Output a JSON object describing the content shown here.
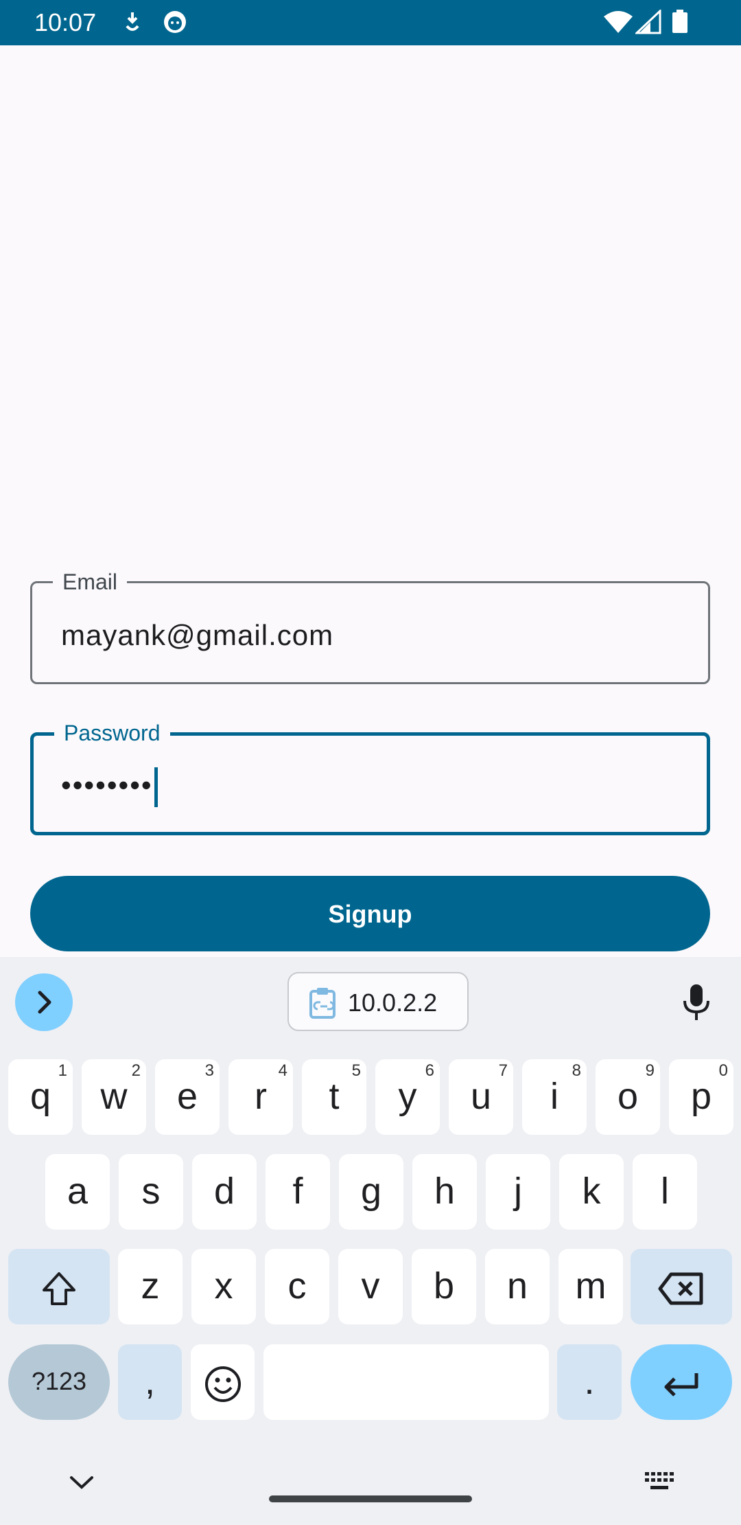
{
  "status_bar": {
    "time": "10:07"
  },
  "form": {
    "email": {
      "label": "Email",
      "value": "mayank@gmail.com"
    },
    "password": {
      "label": "Password",
      "value": "••••••••"
    },
    "signup_label": "Signup"
  },
  "keyboard": {
    "clipboard_suggestion": "10.0.2.2",
    "row1": [
      {
        "k": "q",
        "h": "1"
      },
      {
        "k": "w",
        "h": "2"
      },
      {
        "k": "e",
        "h": "3"
      },
      {
        "k": "r",
        "h": "4"
      },
      {
        "k": "t",
        "h": "5"
      },
      {
        "k": "y",
        "h": "6"
      },
      {
        "k": "u",
        "h": "7"
      },
      {
        "k": "i",
        "h": "8"
      },
      {
        "k": "o",
        "h": "9"
      },
      {
        "k": "p",
        "h": "0"
      }
    ],
    "row2": [
      "a",
      "s",
      "d",
      "f",
      "g",
      "h",
      "j",
      "k",
      "l"
    ],
    "row3": [
      "z",
      "x",
      "c",
      "v",
      "b",
      "n",
      "m"
    ],
    "symbols_label": "?123",
    "comma": ",",
    "period": "."
  },
  "colors": {
    "primary": "#01668f",
    "keyboard_bg": "#eff0f4",
    "accent_key": "#7fcfff"
  }
}
